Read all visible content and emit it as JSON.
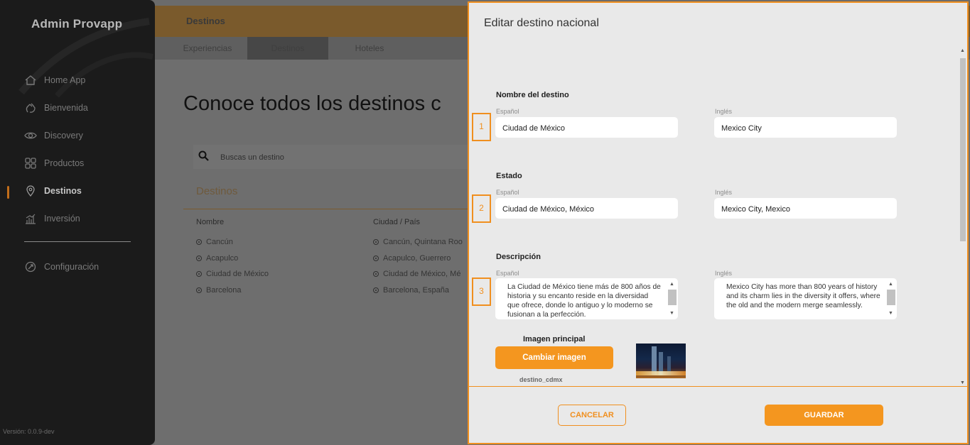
{
  "app": {
    "brand": "Admin Provapp",
    "version": "Versión: 0.0.9-dev"
  },
  "sidebar": {
    "items": [
      {
        "label": "Home App",
        "icon": "home-icon"
      },
      {
        "label": "Bienvenida",
        "icon": "hand-wave-icon"
      },
      {
        "label": "Discovery",
        "icon": "eye-icon"
      },
      {
        "label": "Productos",
        "icon": "grid-icon"
      },
      {
        "label": "Destinos",
        "icon": "map-pin-icon",
        "active": true
      },
      {
        "label": "Inversión",
        "icon": "bar-chart-icon"
      }
    ],
    "settings": {
      "label": "Configuración",
      "icon": "settings-icon"
    }
  },
  "header": {
    "title": "Destinos"
  },
  "subtabs": [
    {
      "label": "Experiencias"
    },
    {
      "label": "Destinos",
      "active": true
    },
    {
      "label": "Hoteles"
    }
  ],
  "main": {
    "hero": "Conoce todos los destinos c",
    "search_placeholder": "Buscas un destino",
    "tab": "Destinos",
    "columns": [
      "Nombre",
      "Ciudad / País"
    ],
    "rows": [
      {
        "name": "Cancún",
        "city": "Cancún, Quintana Roo"
      },
      {
        "name": "Acapulco",
        "city": "Acapulco, Guerrero"
      },
      {
        "name": "Ciudad de México",
        "city": "Ciudad de México, Mé"
      },
      {
        "name": "Barcelona",
        "city": "Barcelona, España"
      }
    ]
  },
  "modal": {
    "title": "Editar destino nacional",
    "sections": [
      {
        "number": "1",
        "heading": "Nombre del destino",
        "es_label": "Español",
        "en_label": "Inglés",
        "es_value": "Ciudad de México",
        "en_value": "Mexico City"
      },
      {
        "number": "2",
        "heading": "Estado",
        "es_label": "Español",
        "en_label": "Inglés",
        "es_value": "Ciudad de México, México",
        "en_value": "Mexico City, Mexico"
      },
      {
        "number": "3",
        "heading": "Descripción",
        "es_label": "Español",
        "en_label": "Inglés",
        "es_value": "La Ciudad de México tiene más de 800 años de historia y su encanto reside en la diversidad que ofrece, donde lo antiguo y lo moderno se fusionan a la perfección.",
        "en_value": "Mexico City has more than 800 years of history and its charm lies in the diversity it offers, where the old and the modern merge seamlessly."
      }
    ],
    "image": {
      "label": "Imagen principal",
      "button": "Cambiar imagen",
      "filename": "destino_cdmx"
    },
    "cancel": "CANCELAR",
    "save": "GUARDAR"
  },
  "colors": {
    "accent": "#f4961f",
    "sidebar_bg": "#1b1b1b",
    "modal_bg": "#e9e9e9"
  }
}
